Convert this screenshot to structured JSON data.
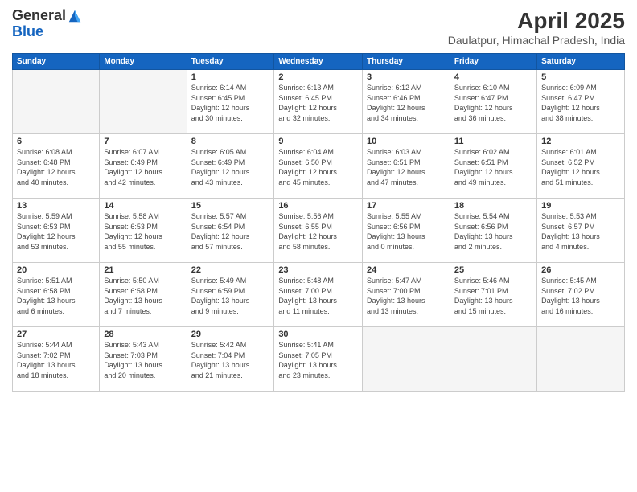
{
  "logo": {
    "general": "General",
    "blue": "Blue"
  },
  "header": {
    "month": "April 2025",
    "location": "Daulatpur, Himachal Pradesh, India"
  },
  "weekdays": [
    "Sunday",
    "Monday",
    "Tuesday",
    "Wednesday",
    "Thursday",
    "Friday",
    "Saturday"
  ],
  "weeks": [
    [
      {
        "day": "",
        "detail": ""
      },
      {
        "day": "",
        "detail": ""
      },
      {
        "day": "1",
        "detail": "Sunrise: 6:14 AM\nSunset: 6:45 PM\nDaylight: 12 hours\nand 30 minutes."
      },
      {
        "day": "2",
        "detail": "Sunrise: 6:13 AM\nSunset: 6:45 PM\nDaylight: 12 hours\nand 32 minutes."
      },
      {
        "day": "3",
        "detail": "Sunrise: 6:12 AM\nSunset: 6:46 PM\nDaylight: 12 hours\nand 34 minutes."
      },
      {
        "day": "4",
        "detail": "Sunrise: 6:10 AM\nSunset: 6:47 PM\nDaylight: 12 hours\nand 36 minutes."
      },
      {
        "day": "5",
        "detail": "Sunrise: 6:09 AM\nSunset: 6:47 PM\nDaylight: 12 hours\nand 38 minutes."
      }
    ],
    [
      {
        "day": "6",
        "detail": "Sunrise: 6:08 AM\nSunset: 6:48 PM\nDaylight: 12 hours\nand 40 minutes."
      },
      {
        "day": "7",
        "detail": "Sunrise: 6:07 AM\nSunset: 6:49 PM\nDaylight: 12 hours\nand 42 minutes."
      },
      {
        "day": "8",
        "detail": "Sunrise: 6:05 AM\nSunset: 6:49 PM\nDaylight: 12 hours\nand 43 minutes."
      },
      {
        "day": "9",
        "detail": "Sunrise: 6:04 AM\nSunset: 6:50 PM\nDaylight: 12 hours\nand 45 minutes."
      },
      {
        "day": "10",
        "detail": "Sunrise: 6:03 AM\nSunset: 6:51 PM\nDaylight: 12 hours\nand 47 minutes."
      },
      {
        "day": "11",
        "detail": "Sunrise: 6:02 AM\nSunset: 6:51 PM\nDaylight: 12 hours\nand 49 minutes."
      },
      {
        "day": "12",
        "detail": "Sunrise: 6:01 AM\nSunset: 6:52 PM\nDaylight: 12 hours\nand 51 minutes."
      }
    ],
    [
      {
        "day": "13",
        "detail": "Sunrise: 5:59 AM\nSunset: 6:53 PM\nDaylight: 12 hours\nand 53 minutes."
      },
      {
        "day": "14",
        "detail": "Sunrise: 5:58 AM\nSunset: 6:53 PM\nDaylight: 12 hours\nand 55 minutes."
      },
      {
        "day": "15",
        "detail": "Sunrise: 5:57 AM\nSunset: 6:54 PM\nDaylight: 12 hours\nand 57 minutes."
      },
      {
        "day": "16",
        "detail": "Sunrise: 5:56 AM\nSunset: 6:55 PM\nDaylight: 12 hours\nand 58 minutes."
      },
      {
        "day": "17",
        "detail": "Sunrise: 5:55 AM\nSunset: 6:56 PM\nDaylight: 13 hours\nand 0 minutes."
      },
      {
        "day": "18",
        "detail": "Sunrise: 5:54 AM\nSunset: 6:56 PM\nDaylight: 13 hours\nand 2 minutes."
      },
      {
        "day": "19",
        "detail": "Sunrise: 5:53 AM\nSunset: 6:57 PM\nDaylight: 13 hours\nand 4 minutes."
      }
    ],
    [
      {
        "day": "20",
        "detail": "Sunrise: 5:51 AM\nSunset: 6:58 PM\nDaylight: 13 hours\nand 6 minutes."
      },
      {
        "day": "21",
        "detail": "Sunrise: 5:50 AM\nSunset: 6:58 PM\nDaylight: 13 hours\nand 7 minutes."
      },
      {
        "day": "22",
        "detail": "Sunrise: 5:49 AM\nSunset: 6:59 PM\nDaylight: 13 hours\nand 9 minutes."
      },
      {
        "day": "23",
        "detail": "Sunrise: 5:48 AM\nSunset: 7:00 PM\nDaylight: 13 hours\nand 11 minutes."
      },
      {
        "day": "24",
        "detail": "Sunrise: 5:47 AM\nSunset: 7:00 PM\nDaylight: 13 hours\nand 13 minutes."
      },
      {
        "day": "25",
        "detail": "Sunrise: 5:46 AM\nSunset: 7:01 PM\nDaylight: 13 hours\nand 15 minutes."
      },
      {
        "day": "26",
        "detail": "Sunrise: 5:45 AM\nSunset: 7:02 PM\nDaylight: 13 hours\nand 16 minutes."
      }
    ],
    [
      {
        "day": "27",
        "detail": "Sunrise: 5:44 AM\nSunset: 7:02 PM\nDaylight: 13 hours\nand 18 minutes."
      },
      {
        "day": "28",
        "detail": "Sunrise: 5:43 AM\nSunset: 7:03 PM\nDaylight: 13 hours\nand 20 minutes."
      },
      {
        "day": "29",
        "detail": "Sunrise: 5:42 AM\nSunset: 7:04 PM\nDaylight: 13 hours\nand 21 minutes."
      },
      {
        "day": "30",
        "detail": "Sunrise: 5:41 AM\nSunset: 7:05 PM\nDaylight: 13 hours\nand 23 minutes."
      },
      {
        "day": "",
        "detail": ""
      },
      {
        "day": "",
        "detail": ""
      },
      {
        "day": "",
        "detail": ""
      }
    ]
  ]
}
